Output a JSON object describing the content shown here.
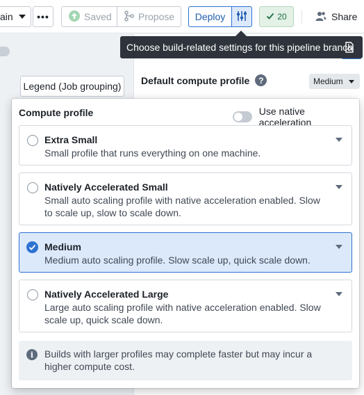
{
  "toolbar": {
    "branch_label": "ain",
    "more_label": "•••",
    "saved_label": "Saved",
    "propose_label": "Propose",
    "deploy_label": "Deploy",
    "checks_count": "20",
    "share_label": "Share"
  },
  "graph": {
    "legend_button": "Legend (Job grouping)"
  },
  "panel": {
    "default_compute_label": "Default compute profile",
    "default_compute_value": "Medium"
  },
  "tooltip": {
    "text": "Choose build-related settings for this pipeline branch"
  },
  "popover": {
    "title": "Compute profile",
    "native_toggle_label": "Use native acceleration",
    "native_toggle_on": false,
    "options": [
      {
        "name": "Extra Small",
        "description": "Small profile that runs everything on one machine.",
        "selected": false
      },
      {
        "name": "Natively Accelerated Small",
        "description": "Small auto scaling profile with native acceleration enabled. Slow to scale up, slow to scale down.",
        "selected": false
      },
      {
        "name": "Medium",
        "description": "Medium auto scaling profile. Slow scale up, quick scale down.",
        "selected": true
      },
      {
        "name": "Natively Accelerated Large",
        "description": "Large auto scaling profile with native acceleration enabled. Slow scale up, quick scale down.",
        "selected": false
      }
    ],
    "info_text": "Builds with larger profiles may complete faster but may incur a higher compute cost."
  },
  "colors": {
    "accent": "#2d72d2",
    "selected_bg": "#dce9fb",
    "tooltip_bg": "#2f343c",
    "success": "#1c6e42"
  }
}
